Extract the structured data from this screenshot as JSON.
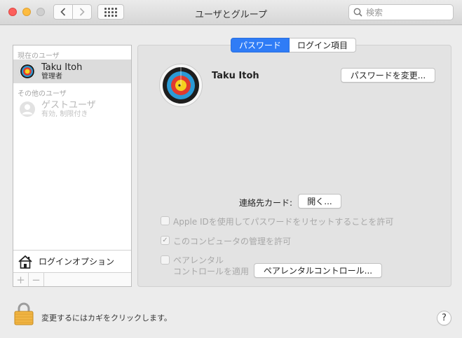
{
  "window": {
    "title": "ユーザとグループ",
    "search_placeholder": "検索"
  },
  "sidebar": {
    "current_section": "現在のユーザ",
    "other_section": "その他のユーザ",
    "users": [
      {
        "name": "Taku Itoh",
        "role": "管理者",
        "selected": true,
        "enabled": true
      },
      {
        "name": "ゲストユーザ",
        "role": "有効, 制限付き",
        "selected": false,
        "enabled": false
      }
    ],
    "login_options": "ログインオプション",
    "add_button": "+",
    "remove_button": "−"
  },
  "tabs": [
    {
      "label": "パスワード",
      "active": true
    },
    {
      "label": "ログイン項目",
      "active": false
    }
  ],
  "detail": {
    "user_name": "Taku Itoh",
    "change_password_button": "パスワードを変更...",
    "contact_label": "連絡先カード:",
    "open_button": "開く...",
    "checkbox_appleid": {
      "label": "Apple IDを使用してパスワードをリセットすることを許可",
      "checked": false,
      "enabled": false
    },
    "checkbox_admin": {
      "label": "このコンピュータの管理を許可",
      "checked": true,
      "enabled": false
    },
    "checkbox_parental": {
      "label_line1": "ペアレンタル",
      "label_line2": "コントロールを適用",
      "checked": false,
      "enabled": false
    },
    "parental_button": "ペアレンタルコントロール..."
  },
  "footer": {
    "lock_text": "変更するにはカギをクリックします。",
    "help_label": "?"
  },
  "colors": {
    "accent": "#2f7cf6",
    "close": "#fc605c",
    "minimize": "#fdbc40",
    "lock_gold": "#f1b544"
  },
  "icons": {
    "avatar": "archery-target-icon",
    "guest": "guest-person-icon",
    "login": "house-icon",
    "lock": "padlock-icon",
    "search": "magnifier-icon"
  }
}
